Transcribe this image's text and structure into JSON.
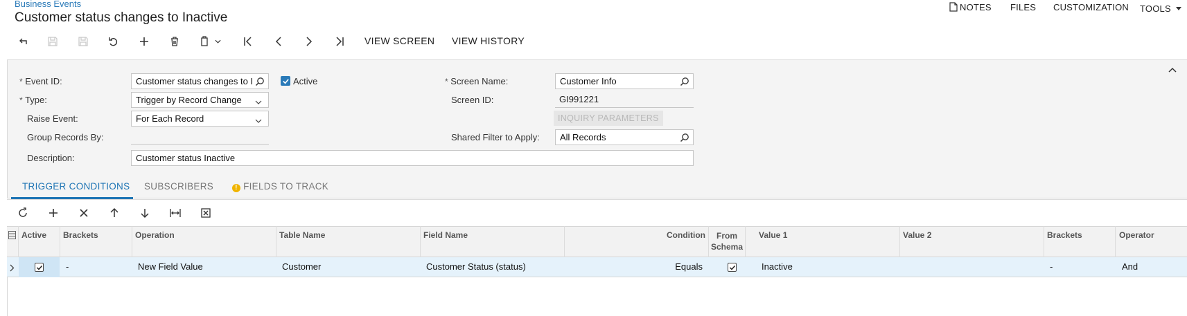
{
  "header": {
    "breadcrumb": "Business Events",
    "title": "Customer status changes to Inactive"
  },
  "top_menu": {
    "notes": "NOTES",
    "files": "FILES",
    "customization": "CUSTOMIZATION",
    "tools": "TOOLS"
  },
  "toolbar": {
    "view_screen": "VIEW SCREEN",
    "view_history": "VIEW HISTORY"
  },
  "form": {
    "event_id_label": "Event ID:",
    "event_id_value": "Customer status changes to I",
    "active_label": "Active",
    "active_checked": true,
    "type_label": "Type:",
    "type_value": "Trigger by Record Change",
    "raise_event_label": "Raise Event:",
    "raise_event_value": "For Each Record",
    "group_records_label": "Group Records By:",
    "group_records_value": "",
    "description_label": "Description:",
    "description_value": "Customer status Inactive",
    "screen_name_label": "Screen Name:",
    "screen_name_value": "Customer Info",
    "screen_id_label": "Screen ID:",
    "screen_id_value": "GI991221",
    "inquiry_parameters": "INQUIRY PARAMETERS",
    "shared_filter_label": "Shared Filter to Apply:",
    "shared_filter_value": "All Records",
    "required_mark": "*"
  },
  "tabs": [
    {
      "label": "TRIGGER CONDITIONS",
      "active": true
    },
    {
      "label": "SUBSCRIBERS",
      "active": false
    },
    {
      "label": "FIELDS TO TRACK",
      "active": false
    }
  ],
  "grid": {
    "columns": {
      "active": "Active",
      "brackets_open": "Brackets",
      "operation": "Operation",
      "table_name": "Table Name",
      "field_name": "Field Name",
      "condition": "Condition",
      "from_schema_1": "From",
      "from_schema_2": "Schema",
      "value1": "Value 1",
      "value2": "Value 2",
      "brackets_close": "Brackets",
      "operator": "Operator"
    },
    "rows": [
      {
        "active": true,
        "brackets_open": "-",
        "operation": "New Field Value",
        "table_name": "Customer",
        "field_name": "Customer Status (status)",
        "condition": "Equals",
        "from_schema": true,
        "value1": "Inactive",
        "value2": "",
        "brackets_close": "-",
        "operator": "And"
      }
    ]
  },
  "colors": {
    "accent": "#2a7ab8",
    "warning": "#f0b400",
    "row_selected": "#e5f2fb"
  }
}
